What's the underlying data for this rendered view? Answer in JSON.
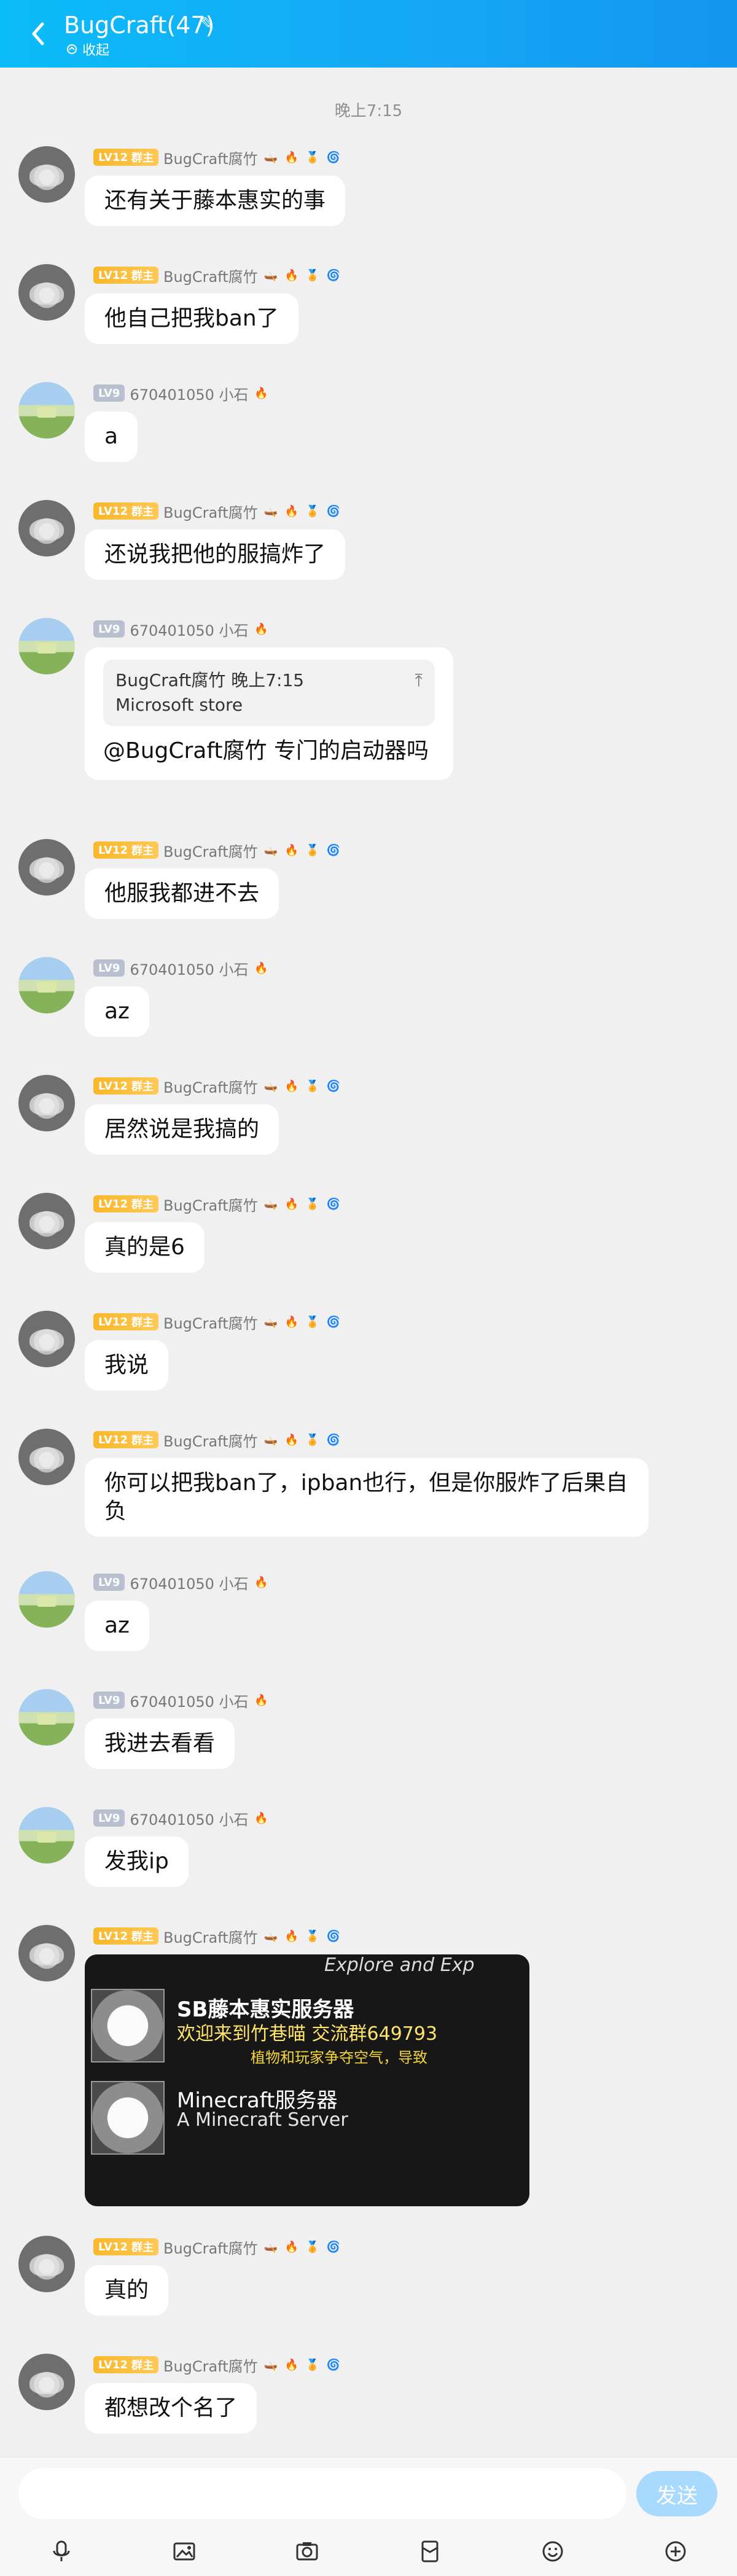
{
  "header": {
    "title": "BugCraft(47)",
    "collapse_label": "收起"
  },
  "timestamp": "晚上7:15",
  "messages": [
    {
      "role": "owner",
      "level": "LV12",
      "role_label": "群主",
      "name": "BugCraft腐竹",
      "text": "还有关于藤本惠实的事"
    },
    {
      "role": "owner",
      "level": "LV12",
      "role_label": "群主",
      "name": "BugCraft腐竹",
      "text": "他自己把我ban了"
    },
    {
      "role": "member",
      "level": "LV9",
      "name": "670401050 小石",
      "text": "a"
    },
    {
      "role": "owner",
      "level": "LV12",
      "role_label": "群主",
      "name": "BugCraft腐竹",
      "text": "还说我把他的服搞炸了"
    },
    {
      "role": "member",
      "level": "LV9",
      "name": "670401050 小石",
      "quote": {
        "name": "BugCraft腐竹",
        "time": "晚上7:15",
        "text": "Microsoft store"
      },
      "text": "@BugCraft腐竹 专门的启动器吗"
    },
    {
      "role": "owner",
      "level": "LV12",
      "role_label": "群主",
      "name": "BugCraft腐竹",
      "text": "他服我都进不去"
    },
    {
      "role": "member",
      "level": "LV9",
      "name": "670401050 小石",
      "text": "az"
    },
    {
      "role": "owner",
      "level": "LV12",
      "role_label": "群主",
      "name": "BugCraft腐竹",
      "text": "居然说是我搞的"
    },
    {
      "role": "owner",
      "level": "LV12",
      "role_label": "群主",
      "name": "BugCraft腐竹",
      "text": "真的是6"
    },
    {
      "role": "owner",
      "level": "LV12",
      "role_label": "群主",
      "name": "BugCraft腐竹",
      "text": "我说"
    },
    {
      "role": "owner",
      "level": "LV12",
      "role_label": "群主",
      "name": "BugCraft腐竹",
      "text": "你可以把我ban了，ipban也行，但是你服炸了后果自负"
    },
    {
      "role": "member",
      "level": "LV9",
      "name": "670401050 小石",
      "text": "az"
    },
    {
      "role": "member",
      "level": "LV9",
      "name": "670401050 小石",
      "text": "我进去看看"
    },
    {
      "role": "member",
      "level": "LV9",
      "name": "670401050 小石",
      "text": "发我ip"
    },
    {
      "role": "owner",
      "level": "LV12",
      "role_label": "群主",
      "name": "BugCraft腐竹",
      "image": {
        "top_text": "Explore and Exp",
        "line1": "SB藤本惠实服务器",
        "line2": "欢迎来到竹巷喵 交流群649793",
        "line3": "植物和玩家争夺空气，导致",
        "line4": "Minecraft服务器",
        "line5": "A Minecraft Server"
      }
    },
    {
      "role": "owner",
      "level": "LV12",
      "role_label": "群主",
      "name": "BugCraft腐竹",
      "text": "真的"
    },
    {
      "role": "owner",
      "level": "LV12",
      "role_label": "群主",
      "name": "BugCraft腐竹",
      "text": "都想改个名了"
    }
  ],
  "composer": {
    "send_label": "发送"
  },
  "toolbar_icons": [
    "mic-icon",
    "image-icon",
    "camera-icon",
    "red-packet-icon",
    "emoji-icon",
    "plus-icon"
  ],
  "colors": {
    "header_start": "#0bbcf8",
    "header_end": "#1296ee",
    "owner_badge": "#f9b82b",
    "member_badge": "#b8bfce",
    "send_button": "#a8d9ff"
  }
}
